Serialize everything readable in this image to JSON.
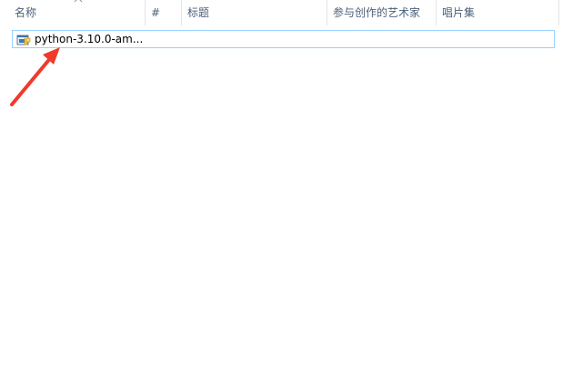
{
  "columns": [
    {
      "label": "名称"
    },
    {
      "label": "#"
    },
    {
      "label": "标题"
    },
    {
      "label": "参与创作的艺术家"
    },
    {
      "label": "唱片集"
    }
  ],
  "sort": {
    "column": "名称",
    "direction": "ascending",
    "icon": "chevron-up-icon"
  },
  "files": [
    {
      "name": "python-3.10.0-am...",
      "icon": "python-installer-icon",
      "selected": true
    }
  ],
  "colors": {
    "header_text": "#4c607a",
    "selection_border": "#99d1ff",
    "annotation": "#f03a2b"
  }
}
